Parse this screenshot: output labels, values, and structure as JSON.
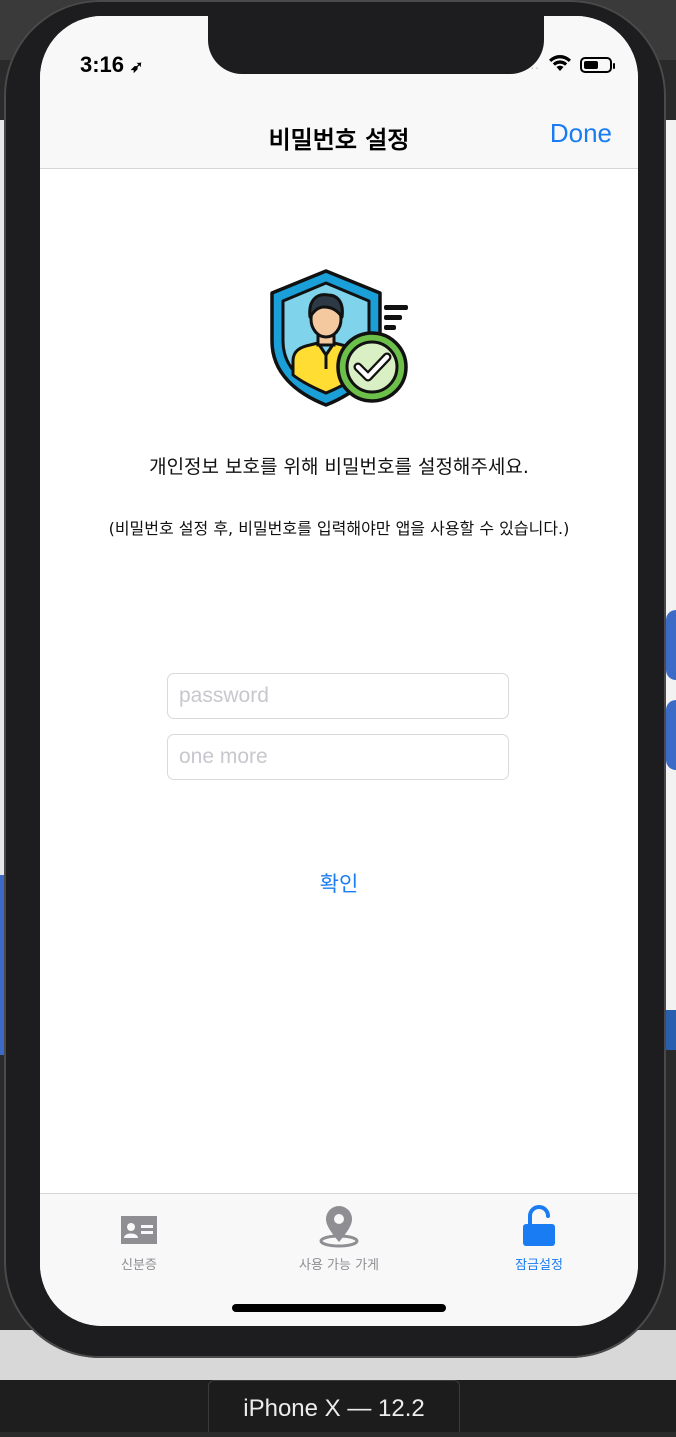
{
  "status_bar": {
    "time": "3:16",
    "location_icon": "location-arrow-icon",
    "signal_dots": "....",
    "wifi_icon": "wifi-icon",
    "battery_icon": "battery-icon"
  },
  "nav": {
    "title": "비밀번호 설정",
    "done_label": "Done"
  },
  "illustration": {
    "icon": "shield-user-check-icon",
    "colors": {
      "shield_outer": "#1a9fd8",
      "shield_inner": "#7fd3ea",
      "shirt": "#ffdd33",
      "badge": "#6cc04a"
    }
  },
  "main": {
    "message": "개인정보 보호를 위해 비밀번호를 설정해주세요.",
    "submessage": "(비밀번호 설정 후, 비밀번호를 입력해야만 앱을 사용할 수 있습니다.)",
    "password_placeholder": "password",
    "confirm_placeholder": "one more",
    "confirm_button": "확인"
  },
  "tab_bar": {
    "tabs": [
      {
        "label": "신분증",
        "icon": "id-card-icon",
        "selected": false
      },
      {
        "label": "사용 가능 가게",
        "icon": "map-pin-icon",
        "selected": false
      },
      {
        "label": "잠금설정",
        "icon": "unlock-icon",
        "selected": true
      }
    ]
  },
  "device": {
    "label": "iPhone X — 12.2"
  },
  "colors": {
    "accent": "#1a7cf2",
    "inactive_tab": "#8e8e93"
  }
}
